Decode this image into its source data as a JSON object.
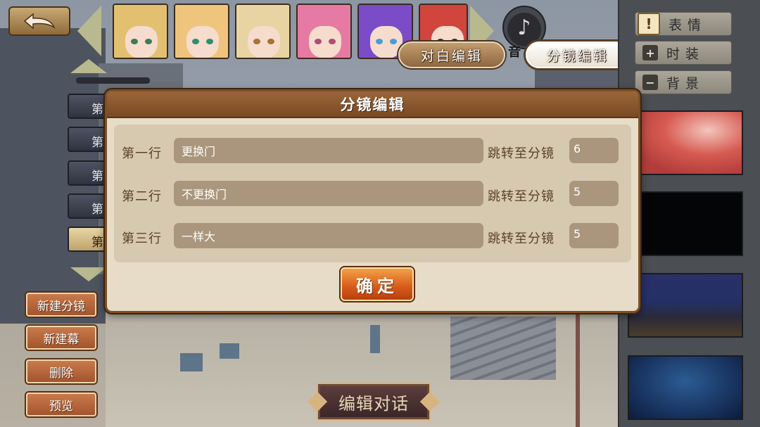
{
  "top_bar": {
    "tabs": {
      "dialogue_edit": "对白编辑",
      "storyboard_edit": "分镜编辑"
    },
    "music_label": "音"
  },
  "portraits": [
    {
      "name": "blonde-girl-1",
      "hair": "#e3c070",
      "eye": "#3f7a58"
    },
    {
      "name": "blonde-girl-2",
      "hair": "#efc57d",
      "eye": "#2f8f6f"
    },
    {
      "name": "blonde-girl-3",
      "hair": "#e8d3a2",
      "eye": "#a8722f"
    },
    {
      "name": "pink-hair-girl",
      "hair": "#e77aa2",
      "eye": "#b24a7a"
    },
    {
      "name": "purple-hair-girl",
      "hair": "#7b4cc8",
      "eye": "#4f9ad6"
    },
    {
      "name": "red-hair-girl",
      "hair": "#d1453d",
      "eye": "#333"
    }
  ],
  "side_tabs": {
    "expression": "表情",
    "costume": "时装",
    "background": "背景"
  },
  "left_panel": {
    "scene_item_prefix": "第",
    "buttons": {
      "new_storyboard": "新建分镜",
      "new_act": "新建幕",
      "delete": "删除",
      "preview": "预览"
    }
  },
  "bottom": {
    "edit_dialogue": "编辑对话"
  },
  "modal": {
    "title": "分镜编辑",
    "rows": [
      {
        "label": "第一行",
        "text": "更换门",
        "jump_label": "跳转至分镜",
        "jump_value": "6"
      },
      {
        "label": "第二行",
        "text": "不更换门",
        "jump_label": "跳转至分镜",
        "jump_value": "5"
      },
      {
        "label": "第三行",
        "text": "一样大",
        "jump_label": "跳转至分镜",
        "jump_value": "5"
      }
    ],
    "confirm": "确定"
  }
}
